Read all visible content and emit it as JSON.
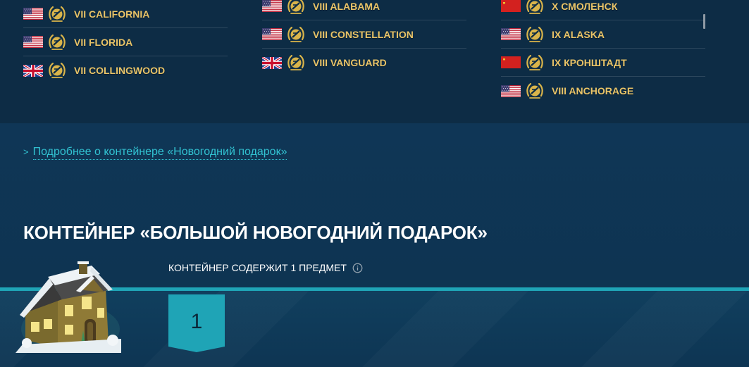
{
  "ships": {
    "columns": [
      {
        "items": [
          {
            "flag": "usa",
            "badge": "laurel-badge-icon",
            "name": "VII CALIFORNIA"
          },
          {
            "flag": "usa",
            "badge": "laurel-badge-icon",
            "name": "VII FLORIDA"
          },
          {
            "flag": "uk",
            "badge": "laurel-badge-icon",
            "name": "VII COLLINGWOOD"
          }
        ]
      },
      {
        "items": [
          {
            "flag": "usa",
            "badge": "laurel-badge-icon",
            "name": "VIII ALABAMA"
          },
          {
            "flag": "usa",
            "badge": "laurel-badge-icon",
            "name": "VIII CONSTELLATION"
          },
          {
            "flag": "uk",
            "badge": "laurel-badge-icon",
            "name": "VIII VANGUARD"
          }
        ]
      },
      {
        "items": [
          {
            "flag": "ussr",
            "badge": "laurel-badge-icon",
            "name": "X СМОЛЕНСК"
          },
          {
            "flag": "usa",
            "badge": "laurel-badge-icon",
            "name": "IX ALASKA"
          },
          {
            "flag": "ussr",
            "badge": "laurel-badge-icon",
            "name": "IX КРОНШТАДТ"
          },
          {
            "flag": "usa",
            "badge": "laurel-badge-icon",
            "name": "VIII ANCHORAGE"
          }
        ]
      }
    ]
  },
  "more_link": {
    "chevron": ">",
    "text": "Подробнее о контейнере «Новогодний подарок»"
  },
  "container": {
    "title": "КОНТЕЙНЕР «БОЛЬШОЙ НОВОГОДНИЙ ПОДАРОК»",
    "contains_label": "КОНТЕЙНЕР СОДЕРЖИТ 1 ПРЕДМЕТ",
    "info_icon": "info-icon",
    "item_count": "1",
    "image_icon": "snowy-house-container-icon"
  },
  "colors": {
    "ship_name": "#e9c468",
    "link": "#32c3d2",
    "accent_teal": "#1fa4b6",
    "background_top": "#0d2c45",
    "background_bottom": "#0f3552"
  }
}
